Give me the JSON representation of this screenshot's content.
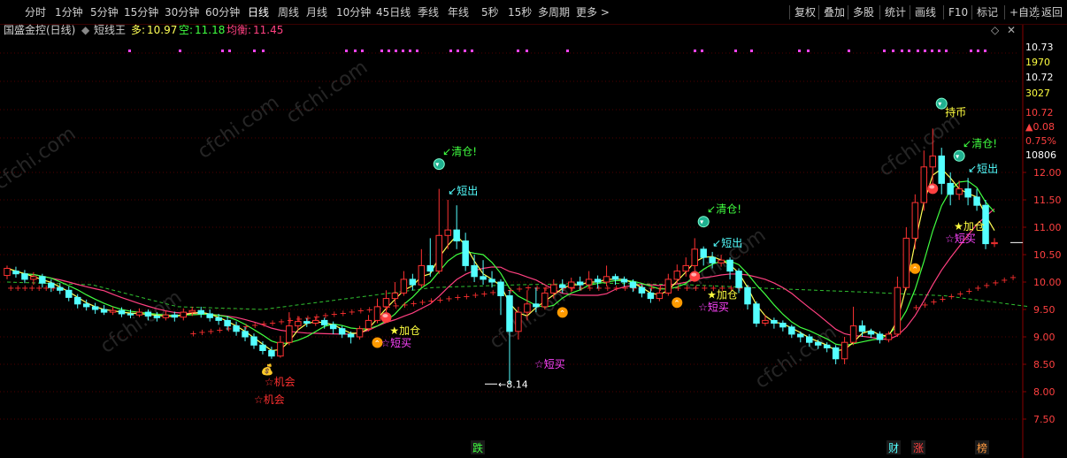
{
  "toolbar": {
    "tabs": [
      "分时",
      "1分钟",
      "5分钟",
      "15分钟",
      "30分钟",
      "60分钟",
      "日线",
      "周线",
      "月线",
      "10分钟",
      "45日线",
      "季线",
      "年线",
      "5秒",
      "15秒",
      "多周期",
      "更多"
    ],
    "more_chevron": ">",
    "active_tab": "日线",
    "right_buttons": [
      "复权",
      "叠加",
      "多股",
      "统计",
      "画线",
      "F10",
      "标记",
      "+自选",
      "返回"
    ]
  },
  "info": {
    "stock_name": "国盛金控(日线)",
    "indicator": "短线王",
    "duo_label": "多:",
    "duo_value": "10.97",
    "kong_label": "空:",
    "kong_value": "11.18",
    "junheng_label": "均衡:",
    "junheng_value": "11.45",
    "colors": {
      "duo": "#ffff55",
      "kong": "#40ff40",
      "junheng": "#ff4080"
    }
  },
  "right_axis": {
    "info": [
      {
        "text": "10.73",
        "color": "#ffffff"
      },
      {
        "text": "1970",
        "color": "#ffff40"
      },
      {
        "text": "10.72",
        "color": "#ffffff"
      },
      {
        "text": "3027",
        "color": "#ffff40"
      },
      {
        "text": "10.72",
        "color": "#ff4040"
      },
      {
        "text": "▲0.08",
        "color": "#ff4040"
      },
      {
        "text": "0.75%",
        "color": "#ff4040"
      },
      {
        "text": "10806",
        "color": "#ffffff"
      }
    ],
    "ticks": [
      "12.00",
      "11.50",
      "11.00",
      "10.50",
      "10.00",
      "9.50",
      "9.00",
      "8.50",
      "8.00",
      "7.50"
    ]
  },
  "annotations": {
    "qingcang": "清仓!",
    "duanchu": "短出",
    "chibi": "持币",
    "jiacang": "加仓",
    "duanmai": "☆短买",
    "jihui": "☆机会",
    "low_price": "8.14",
    "bottom_die": "跌",
    "bottom_cai": "财",
    "bottom_zhang": "涨",
    "bottom_bang": "榜"
  },
  "watermark": "cfchi.com",
  "colors": {
    "up": "#ff3232",
    "down": "#54ffff",
    "grid": "#500000",
    "duo_line": "#ffff55",
    "kong_line": "#40ff40",
    "jh_line": "#ff4080",
    "purple": "#ff44ff"
  },
  "chart_data": {
    "type": "candlestick",
    "y_range": [
      7.2,
      12.5
    ],
    "y_ticks": [
      7.5,
      8,
      8.5,
      9,
      9.5,
      10,
      10.5,
      11,
      11.5,
      12
    ],
    "low_marker": 8.14,
    "candles": [
      [
        10.12,
        10.25,
        10.05,
        10.3
      ],
      [
        10.2,
        10.15,
        10.08,
        10.28
      ],
      [
        10.15,
        10.05,
        9.98,
        10.22
      ],
      [
        10.05,
        10.1,
        9.95,
        10.18
      ],
      [
        10.1,
        9.98,
        9.9,
        10.15
      ],
      [
        9.98,
        9.9,
        9.82,
        10.05
      ],
      [
        9.9,
        9.85,
        9.78,
        9.98
      ],
      [
        9.85,
        9.72,
        9.65,
        9.92
      ],
      [
        9.72,
        9.6,
        9.52,
        9.78
      ],
      [
        9.6,
        9.55,
        9.48,
        9.68
      ],
      [
        9.55,
        9.5,
        9.42,
        9.62
      ],
      [
        9.5,
        9.45,
        9.4,
        9.58
      ],
      [
        9.45,
        9.48,
        9.4,
        9.55
      ],
      [
        9.48,
        9.42,
        9.36,
        9.54
      ],
      [
        9.42,
        9.4,
        9.34,
        9.5
      ],
      [
        9.4,
        9.45,
        9.36,
        9.52
      ],
      [
        9.45,
        9.38,
        9.3,
        9.5
      ],
      [
        9.38,
        9.35,
        9.28,
        9.45
      ],
      [
        9.35,
        9.4,
        9.3,
        9.48
      ],
      [
        9.4,
        9.36,
        9.28,
        9.46
      ],
      [
        9.36,
        9.45,
        9.3,
        9.52
      ],
      [
        9.45,
        9.48,
        9.38,
        9.55
      ],
      [
        9.48,
        9.42,
        9.35,
        9.55
      ],
      [
        9.42,
        9.35,
        9.28,
        9.5
      ],
      [
        9.35,
        9.3,
        9.22,
        9.42
      ],
      [
        9.3,
        9.2,
        9.12,
        9.38
      ],
      [
        9.2,
        9.1,
        9.02,
        9.28
      ],
      [
        9.1,
        9.0,
        8.92,
        9.18
      ],
      [
        9.0,
        8.85,
        8.78,
        9.06
      ],
      [
        8.85,
        8.75,
        8.68,
        8.92
      ],
      [
        8.75,
        8.65,
        8.6,
        8.82
      ],
      [
        8.65,
        8.9,
        8.62,
        9.02
      ],
      [
        8.9,
        9.2,
        8.85,
        9.45
      ],
      [
        9.2,
        9.28,
        9.12,
        9.38
      ],
      [
        9.28,
        9.25,
        9.18,
        9.34
      ],
      [
        9.25,
        9.3,
        9.2,
        9.36
      ],
      [
        9.3,
        9.22,
        9.15,
        9.35
      ],
      [
        9.22,
        9.15,
        9.05,
        9.28
      ],
      [
        9.15,
        9.05,
        8.98,
        9.2
      ],
      [
        9.05,
        9.0,
        8.88,
        9.1
      ],
      [
        9.0,
        9.15,
        8.95,
        9.2
      ],
      [
        9.15,
        9.3,
        9.1,
        9.4
      ],
      [
        9.3,
        9.55,
        9.25,
        9.7
      ],
      [
        9.55,
        9.7,
        9.45,
        9.85
      ],
      [
        9.7,
        9.8,
        9.6,
        10.0
      ],
      [
        9.8,
        10.05,
        9.75,
        10.2
      ],
      [
        10.05,
        9.95,
        9.85,
        10.15
      ],
      [
        9.95,
        10.3,
        9.9,
        10.6
      ],
      [
        10.3,
        10.2,
        10.1,
        10.8
      ],
      [
        10.2,
        10.85,
        10.15,
        11.7
      ],
      [
        10.85,
        10.95,
        10.6,
        11.5
      ],
      [
        10.95,
        10.75,
        10.6,
        11.4
      ],
      [
        10.75,
        10.3,
        10.2,
        10.9
      ],
      [
        10.3,
        10.1,
        10.0,
        10.5
      ],
      [
        10.1,
        10.05,
        9.95,
        10.4
      ],
      [
        10.05,
        10.0,
        9.9,
        10.2
      ],
      [
        10.0,
        9.75,
        9.4,
        10.05
      ],
      [
        9.75,
        9.1,
        8.14,
        9.85
      ],
      [
        9.1,
        9.45,
        8.95,
        9.55
      ],
      [
        9.45,
        9.6,
        9.3,
        9.85
      ],
      [
        9.6,
        9.55,
        9.45,
        9.9
      ],
      [
        9.55,
        9.8,
        9.5,
        9.9
      ],
      [
        9.8,
        9.95,
        9.7,
        10.05
      ],
      [
        9.95,
        9.9,
        9.8,
        10.05
      ],
      [
        9.9,
        10.0,
        9.82,
        10.08
      ],
      [
        10.0,
        9.95,
        9.85,
        10.1
      ],
      [
        9.95,
        10.05,
        9.9,
        10.2
      ],
      [
        10.05,
        10.0,
        9.88,
        10.12
      ],
      [
        10.0,
        10.1,
        9.92,
        10.3
      ],
      [
        10.1,
        10.05,
        9.95,
        10.15
      ],
      [
        10.05,
        10.0,
        9.92,
        10.1
      ],
      [
        10.0,
        9.9,
        9.82,
        10.05
      ],
      [
        9.9,
        9.8,
        9.72,
        9.95
      ],
      [
        9.8,
        9.7,
        9.62,
        9.88
      ],
      [
        9.7,
        9.8,
        9.65,
        9.9
      ],
      [
        9.8,
        10.05,
        9.75,
        10.15
      ],
      [
        10.05,
        10.2,
        9.98,
        10.32
      ],
      [
        10.2,
        10.3,
        10.1,
        10.45
      ],
      [
        10.3,
        10.6,
        10.2,
        10.8
      ],
      [
        10.6,
        10.45,
        10.3,
        10.65
      ],
      [
        10.45,
        10.35,
        10.25,
        10.55
      ],
      [
        10.35,
        10.4,
        10.28,
        10.5
      ],
      [
        10.4,
        10.2,
        10.05,
        10.45
      ],
      [
        10.2,
        9.9,
        9.8,
        10.25
      ],
      [
        9.9,
        9.6,
        9.5,
        9.95
      ],
      [
        9.6,
        9.25,
        9.18,
        9.65
      ],
      [
        9.25,
        9.3,
        9.2,
        9.4
      ],
      [
        9.3,
        9.25,
        9.15,
        9.35
      ],
      [
        9.25,
        9.18,
        9.1,
        9.3
      ],
      [
        9.18,
        9.05,
        8.98,
        9.22
      ],
      [
        9.05,
        9.0,
        8.9,
        9.1
      ],
      [
        9.0,
        8.9,
        8.82,
        9.05
      ],
      [
        8.9,
        8.85,
        8.78,
        8.95
      ],
      [
        8.85,
        8.8,
        8.72,
        8.9
      ],
      [
        8.8,
        8.6,
        8.5,
        8.85
      ],
      [
        8.6,
        8.9,
        8.5,
        9.0
      ],
      [
        8.9,
        9.2,
        8.85,
        9.55
      ],
      [
        9.2,
        9.1,
        9.0,
        9.3
      ],
      [
        9.1,
        9.05,
        8.98,
        9.15
      ],
      [
        9.05,
        8.95,
        8.88,
        9.1
      ],
      [
        8.95,
        9.05,
        8.9,
        9.1
      ],
      [
        9.05,
        9.9,
        9.0,
        10.1
      ],
      [
        9.9,
        10.8,
        9.85,
        11.0
      ],
      [
        10.8,
        11.45,
        10.6,
        11.6
      ],
      [
        11.45,
        12.1,
        11.3,
        12.4
      ],
      [
        12.1,
        12.3,
        11.8,
        12.8
      ],
      [
        12.3,
        11.8,
        11.6,
        12.45
      ],
      [
        11.8,
        11.6,
        11.4,
        12.0
      ],
      [
        11.6,
        11.7,
        11.5,
        11.85
      ],
      [
        11.7,
        11.55,
        11.4,
        11.9
      ],
      [
        11.55,
        11.4,
        11.3,
        11.7
      ],
      [
        11.4,
        10.7,
        10.6,
        11.5
      ],
      [
        10.7,
        10.72,
        10.64,
        10.8
      ]
    ],
    "ma_long_y": [
      10.0,
      9.95,
      9.55,
      9.5,
      9.7,
      9.9,
      9.95,
      9.98,
      9.95,
      9.88,
      9.82,
      9.75,
      9.55
    ],
    "signals": [
      {
        "type": "qingcang",
        "idx": 49
      },
      {
        "type": "duanchu",
        "idx": 50
      },
      {
        "type": "qingcang",
        "idx": 79
      },
      {
        "type": "duanchu",
        "idx": 80
      },
      {
        "type": "qingcang",
        "idx": 108
      },
      {
        "type": "duanchu",
        "idx": 109
      },
      {
        "type": "chibi",
        "idx": 106
      },
      {
        "type": "buy",
        "idx": 42
      },
      {
        "type": "buy",
        "idx": 63
      },
      {
        "type": "buy",
        "idx": 76
      },
      {
        "type": "buy",
        "idx": 103
      },
      {
        "type": "sell",
        "idx": 43
      },
      {
        "type": "sell",
        "idx": 78
      },
      {
        "type": "sell",
        "idx": 105
      },
      {
        "type": "jihui",
        "idx": 30
      },
      {
        "type": "jiacang",
        "idx": 44
      },
      {
        "type": "jiacang",
        "idx": 80
      },
      {
        "type": "jiacang",
        "idx": 108
      }
    ]
  }
}
